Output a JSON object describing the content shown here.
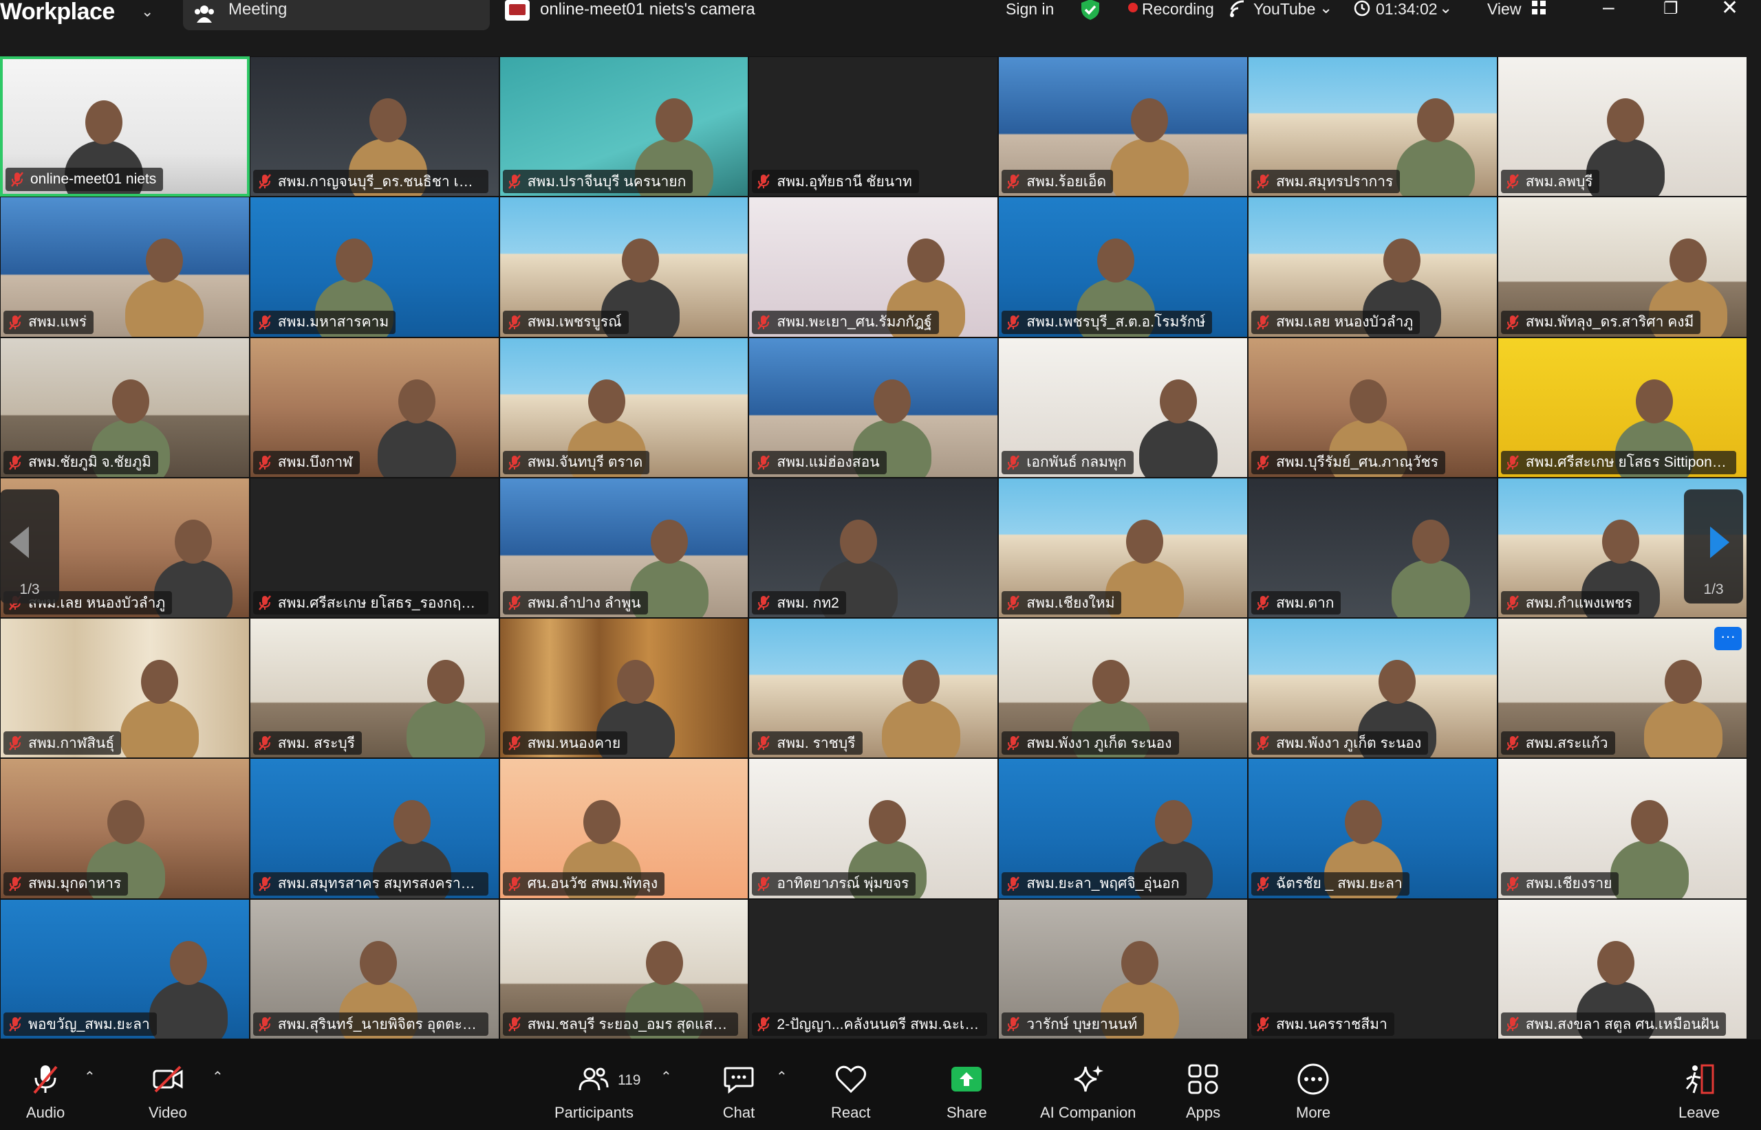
{
  "topbar": {
    "brand": "Workplace",
    "meeting_tab_label": "Meeting",
    "camera_label": "online-meet01 niets's camera",
    "sign_in": "Sign in",
    "recording": "Recording",
    "youtube": "YouTube",
    "timer": "01:34:02",
    "view": "View"
  },
  "pager": {
    "left_page": "1/3",
    "right_page": "1/3"
  },
  "tiles": [
    "online-meet01 niets",
    "สพม.กาญจนบุรี_ดร.ชนธิชา เตชะพ...",
    "สพม.ปราจีนบุรี นครนายก",
    "สพม.อุทัยธานี ชัยนาท",
    "สพม.ร้อยเอ็ด",
    "สพม.สมุทรปราการ",
    "สพม.ลพบุรี",
    "สพม.แพร่",
    "สพม.มหาสารคาม",
    "สพม.เพชรบูรณ์",
    "สพม.พะเยา_ศน.รัมภกัฎฐ์",
    "สพม.เพชรบุรี_ส.ต.อ.โรมรักษ์",
    "สพม.เลย หนองบัวลำภู",
    "สพม.พัทลุง_ดร.สาริศา คงมี",
    "สพม.ชัยภูมิ จ.ชัยภูมิ",
    "สพม.บึงกาฬ",
    "สพม.จันทบุรี ตราด",
    "สพม.แม่ฮ่องสอน",
    "เอกพันธ์ กลมพุก",
    "สพม.บุรีรัมย์_ศน.ภาณุวัชร",
    "สพม.ศรีสะเกษ ยโสธร Sittipong Su...",
    "สพม.เลย หนองบัวลำภู",
    "สพม.ศรีสะเกษ ยโสธร_รองกฤษฎา",
    "สพม.ลำปาง ลำพูน",
    "สพม. กท2",
    "สพม.เชียงใหม่",
    "สพม.ตาก",
    "สพม.กำแพงเพชร",
    "สพม.กาฬสินธุ์",
    "สพม. สระบุรี",
    "สพม.หนองคาย",
    "สพม. ราชบุรี",
    "สพม.พังงา ภูเก็ต ระนอง",
    "สพม.พังงา ภูเก็ต ระนอง",
    "สพม.สระแก้ว",
    "สพม.มุกดาหาร",
    "สพม.สมุทรสาคร สมุทรสงคราม ผอ....",
    "ศน.อนวัช สพม.พัทลุง",
    "อาทิตยาภรณ์ พุ่มขจร",
    "สพม.ยะลา_พฤศจิ_อุ่นอก",
    "ฉัตรชัย _ สพม.ยะลา",
    "สพม.เชียงราย",
    "พอขวัญ_สพม.ยะลา",
    "สพม.สุรินทร์_นายพิจิตร อุตตะโปน",
    "สพม.ชลบุรี ระยอง_อมร สุดแสง_ผ...",
    "2-ปัญญา...คลังนนตรี สพม.ฉะเชิงเ...",
    "วารักษ์ บุษยานนท์",
    "สพม.นครราชสีมา",
    "สพม.สงขลา สตูล ศน.เหมือนฝัน"
  ],
  "toolbar": {
    "audio": "Audio",
    "video": "Video",
    "participants": "Participants",
    "participants_count": "119",
    "chat": "Chat",
    "react": "React",
    "share": "Share",
    "ai_companion": "AI Companion",
    "apps": "Apps",
    "more": "More",
    "leave": "Leave"
  },
  "colors": {
    "active_border": "#2ec866",
    "share_green": "#1db954",
    "record_red": "#e02828",
    "leave_red": "#e53935",
    "mic_muted_red": "#e53935",
    "pager_blue": "#1e88e5"
  }
}
